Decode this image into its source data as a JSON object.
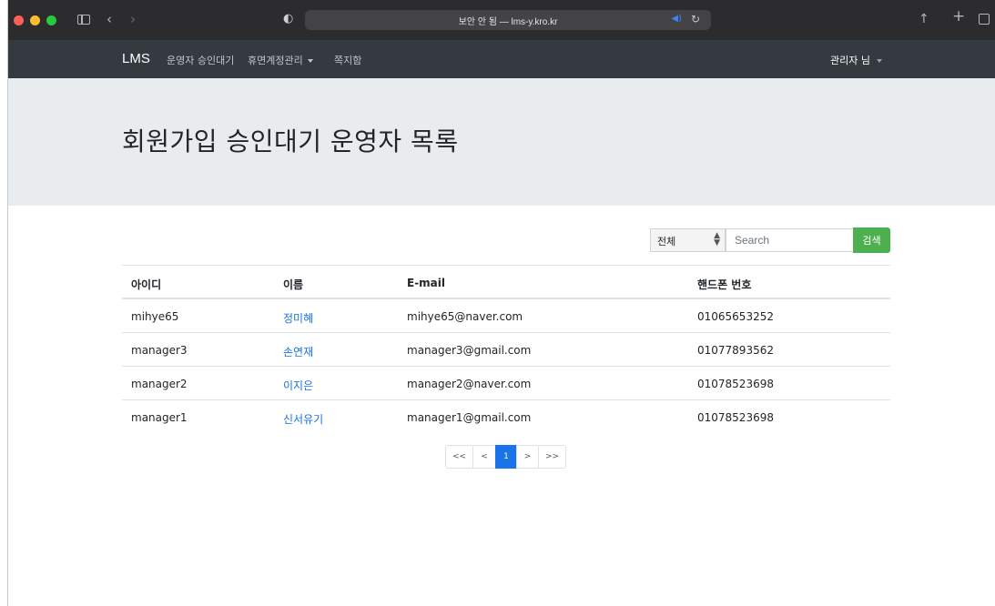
{
  "browser": {
    "url_text": "보안 안 됨 — lms-y.kro.kr",
    "icons": [
      "sidebar-icon",
      "back-icon",
      "forward-icon",
      "shield-icon",
      "speaker-icon",
      "reload-icon",
      "share-icon",
      "new-tab-icon",
      "tabs-overview-icon"
    ]
  },
  "navbar": {
    "brand": "LMS",
    "links": [
      "운영자 승인대기",
      "휴면계정관리",
      "쪽지함"
    ],
    "user_menu": "관리자 님"
  },
  "page": {
    "title": "회원가입 승인대기 운영자 목록"
  },
  "search": {
    "filter_selected": "전체",
    "placeholder": "Search",
    "button_label": "검색"
  },
  "table": {
    "columns": [
      "아이디",
      "이름",
      "E-mail",
      "핸드폰 번호"
    ],
    "rows": [
      {
        "id": "mihye65",
        "name": "정미혜",
        "email": "mihye65@naver.com",
        "phone": "01065653252"
      },
      {
        "id": "manager3",
        "name": "손연재",
        "email": "manager3@gmail.com",
        "phone": "01077893562"
      },
      {
        "id": "manager2",
        "name": "이지은",
        "email": "manager2@naver.com",
        "phone": "01078523698"
      },
      {
        "id": "manager1",
        "name": "신서유기",
        "email": "manager1@gmail.com",
        "phone": "01078523698"
      }
    ]
  },
  "pagination": {
    "first": "<<",
    "prev": "<",
    "current": "1",
    "next": ">",
    "last": ">>"
  },
  "colors": {
    "navbar_bg": "#343a40",
    "jumbotron_bg": "#e9ecef",
    "link": "#1a73e8",
    "search_button": "#4caf50",
    "active_page": "#1a73e8"
  }
}
